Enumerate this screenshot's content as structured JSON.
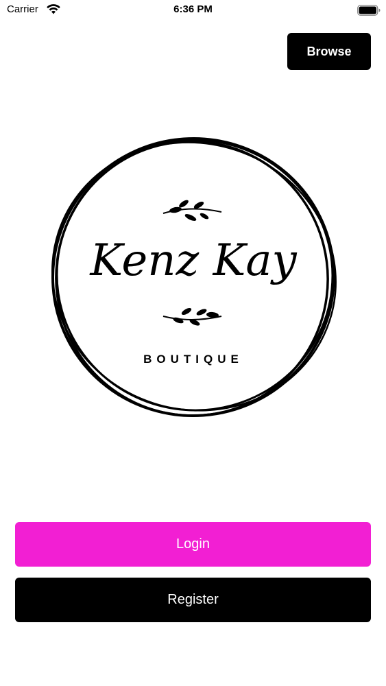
{
  "status_bar": {
    "carrier": "Carrier",
    "time": "6:36 PM"
  },
  "header": {
    "browse_label": "Browse"
  },
  "logo": {
    "brand_name": "Kenz Kay",
    "subtitle": "BOUTIQUE"
  },
  "actions": {
    "login_label": "Login",
    "register_label": "Register"
  },
  "colors": {
    "login_background": "#f21fd3",
    "register_background": "#000000",
    "browse_background": "#000000",
    "text_on_buttons": "#ffffff"
  },
  "icons": {
    "wifi": "wifi-icon",
    "battery": "battery-icon",
    "top_sprig": "leaf-sprig-icon",
    "bottom_sprig": "leaf-sprig-icon"
  }
}
